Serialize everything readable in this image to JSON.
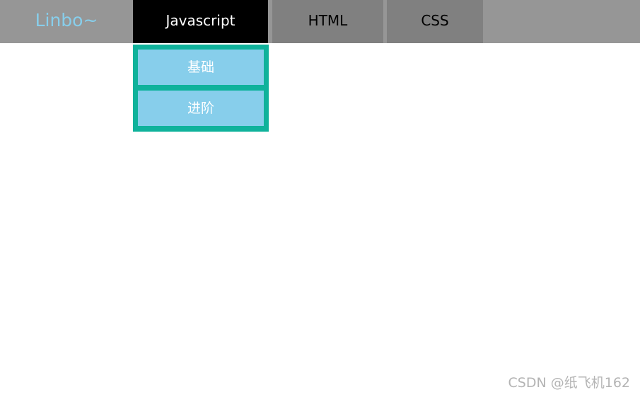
{
  "nav": {
    "logo": "Linbo~",
    "tabs": [
      {
        "label": "Javascript",
        "active": true
      },
      {
        "label": "HTML",
        "active": false
      },
      {
        "label": "CSS",
        "active": false
      }
    ]
  },
  "dropdown": {
    "items": [
      {
        "label": "基础"
      },
      {
        "label": "进阶"
      }
    ]
  },
  "watermark": "CSDN @纸飞机162",
  "colors": {
    "nav_bg": "#969696",
    "tab_bg": "#808080",
    "active_tab_bg": "#000000",
    "logo_text": "#87ceeb",
    "dropdown_border": "#0fb29b",
    "dropdown_item_bg": "#87ceeb"
  }
}
